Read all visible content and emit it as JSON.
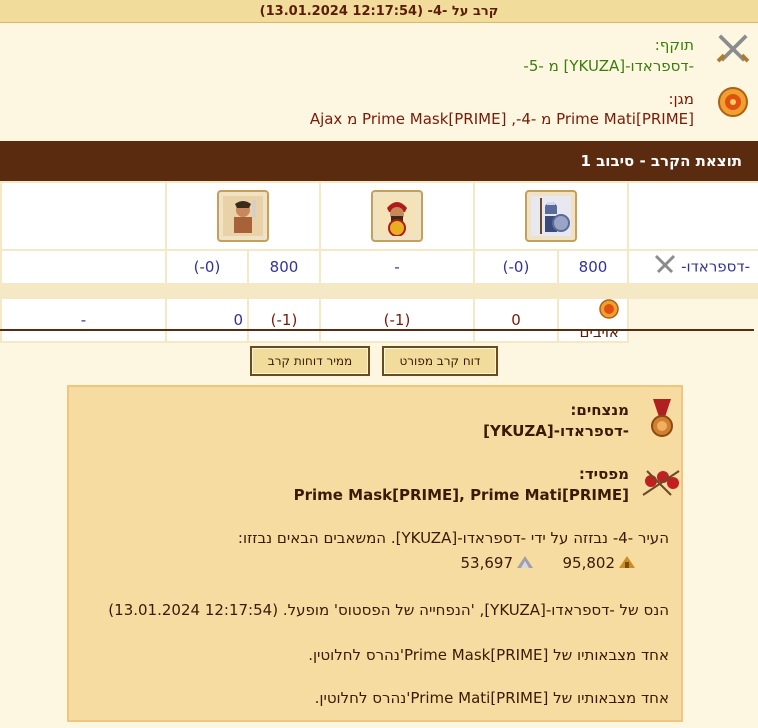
{
  "window": {
    "title": "קרב על -4- (12:17:54 13.01.2024)"
  },
  "attacker": {
    "label": "תוקף:",
    "names": "-דספראדו-[YKUZA] מ -5-",
    "icon": "crossed-swords-icon"
  },
  "defender": {
    "label": "מגן:",
    "names": "Prime Mati[PRIME] מ -4-, Prime Mask[PRIME] מ Ajax",
    "icon": "shield-icon"
  },
  "result_bar": {
    "title": "תוצאת הקרב - סיבוב 1"
  },
  "battle_table": {
    "units": [
      {
        "name": "spartan-hoplite",
        "icon": "hoplite-icon"
      },
      {
        "name": "archer",
        "icon": "archer-icon"
      },
      {
        "name": "swordsman",
        "icon": "swordsman-icon"
      }
    ],
    "rows": [
      {
        "label": "-דספראדו-",
        "icon": "crossed-swords-icon",
        "cells": [
          {
            "count": "800",
            "lost": "(-0)"
          },
          {
            "count": "-",
            "lost": ""
          },
          {
            "count": "800",
            "lost": "(-0)"
          }
        ]
      },
      {
        "label": "אויבים",
        "icon": "shield-icon",
        "cells": [
          {
            "count": "0",
            "lost": "(-1)"
          },
          {
            "count": "0",
            "lost": "(-1)"
          },
          {
            "count": "-",
            "lost": ""
          }
        ]
      }
    ]
  },
  "buttons": {
    "detailed_report": "דוח קרב מפורט",
    "sorter": "ממיר דוחות קרב"
  },
  "summary": {
    "winners_label": "מנצחים:",
    "winners": "-דספראדו-[YKUZA]",
    "loser_label": "מפסיד:",
    "losers": "Prime Mask[PRIME], Prime Mati[PRIME]",
    "loot_text": "העיר -4- נבזזה על ידי -דספראדו-[YKUZA]. המשאבים הבאים נבזזו:",
    "loot_wood": "95,802",
    "loot_marble": "53,697",
    "event1": "הנס של -דספראדו-[YKUZA], 'הנפחייה של הפסטוס' מופעל. (12:17:54 13.01.2024)",
    "event2": "אחד מצבאותיו של Prime Mask[PRIME]'נהרס לחלוטין.",
    "event3": "אחד מצבאותיו של Prime Mati[PRIME]'נהרס לחלוטין."
  }
}
